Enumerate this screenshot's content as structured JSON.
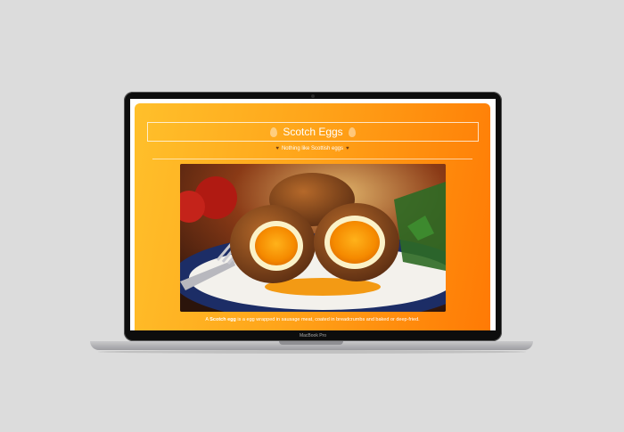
{
  "device": {
    "brand_label": "MacBook Pro"
  },
  "page": {
    "title": "Scotch Eggs",
    "subtitle": "Nothing like Scottish eggs",
    "image_alt": "Scotch eggs cut in half on a plate with a fork",
    "caption_prefix": "A ",
    "caption_bold": "Scotch egg",
    "caption_rest": " is a egg wrapped in sausage meat, coated in breadcrumbs and baked or deep-fried."
  },
  "colors": {
    "background": "#dcdcdc",
    "gradient_start": "#ffc02b",
    "gradient_end": "#ff7a05",
    "text": "#ffffff"
  },
  "icons": [
    "egg-icon",
    "heart-icon"
  ]
}
